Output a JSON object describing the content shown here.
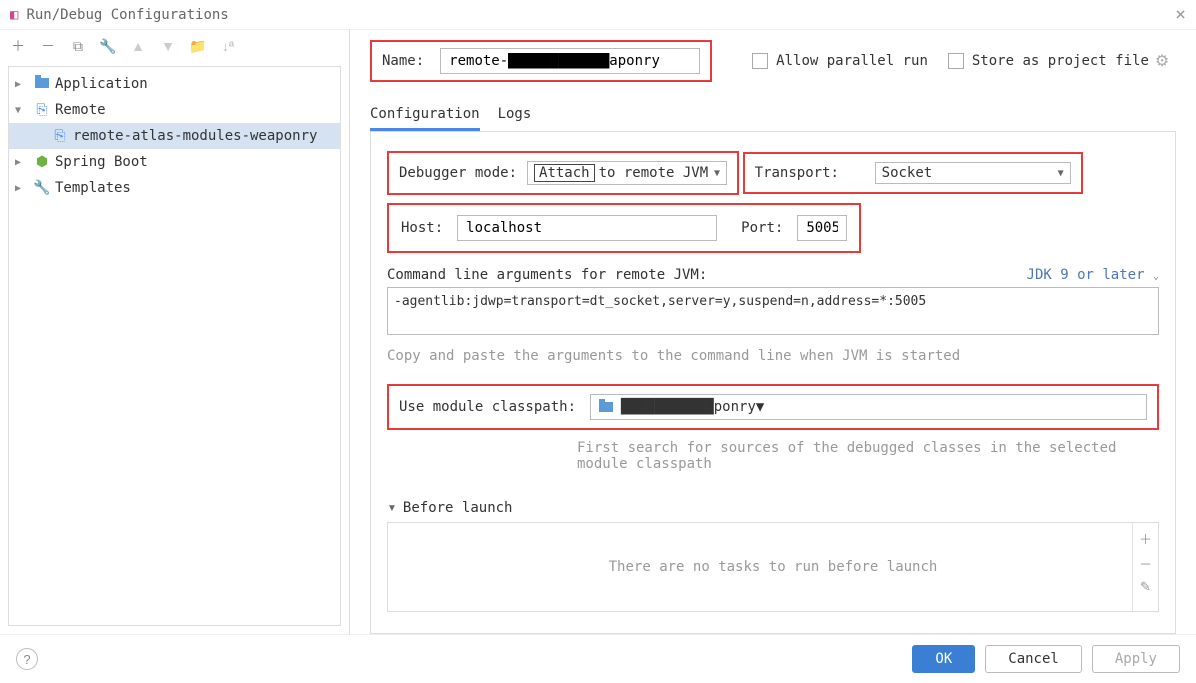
{
  "titlebar": {
    "title": "Run/Debug Configurations"
  },
  "tree": {
    "items": [
      {
        "label": "Application"
      },
      {
        "label": "Remote"
      },
      {
        "label": "remote-atlas-modules-weaponry"
      },
      {
        "label": "Spring Boot"
      },
      {
        "label": "Templates"
      }
    ]
  },
  "topRow": {
    "nameLabel": "Name:",
    "nameValue": "remote-████████████aponry",
    "parallelLabel": "Allow parallel run",
    "storeLabel": "Store as project file"
  },
  "tabs": {
    "configuration": "Configuration",
    "logs": "Logs"
  },
  "config": {
    "debuggerModeLabel": "Debugger mode:",
    "attachWord": "Attach",
    "attachRest": "to remote JVM",
    "transportLabel": "Transport:",
    "transportValue": "Socket",
    "hostLabel": "Host:",
    "hostValue": "localhost",
    "portLabel": "Port:",
    "portValue": "5005",
    "cmdLabel": "Command line arguments for remote JVM:",
    "jdkLabel": "JDK 9 or later",
    "cmdValue": "-agentlib:jdwp=transport=dt_socket,server=y,suspend=n,address=*:5005",
    "cmdHint": "Copy and paste the arguments to the command line when JVM is started",
    "moduleLabel": "Use module classpath:",
    "moduleValue": "███████████ponry",
    "moduleHint1": "First search for sources of the debugged classes in the selected",
    "moduleHint2": "module classpath",
    "beforeLaunchLabel": "Before launch",
    "noTasks": "There are no tasks to run before launch"
  },
  "footer": {
    "ok": "OK",
    "cancel": "Cancel",
    "apply": "Apply"
  }
}
